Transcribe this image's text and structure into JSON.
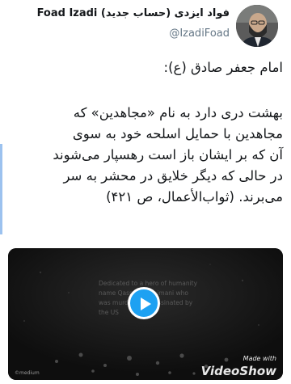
{
  "user": {
    "display_name": "Foad Izadi فواد ایزدی (حساب جدید)",
    "handle": "@IzadiFoad",
    "avatar_icon": "user-avatar"
  },
  "tweet": {
    "lines": [
      "امام جعفر صادق (ع):",
      "بهشت دری دارد به نام «مجاهدین» که",
      "مجاهدین با حمایل اسلحه خود به سوی",
      "آن که بر ایشان باز است رهسپار می‌شوند",
      "در حالی که دیگر خلایق در محشر به سر",
      "می‌برند. (ثواب‌الأعمال، ص ۴۲۱)"
    ]
  },
  "video": {
    "dedication": "Dedicated to a hero of humanity\nname Qassem Soleimani who\nwas murdered assassinated by\nthe US",
    "credit": "©medium",
    "watermark_top": "Made with",
    "watermark_brand": "VideoShow",
    "play_icon": "play-icon",
    "accent_color": "#1da1f2"
  }
}
